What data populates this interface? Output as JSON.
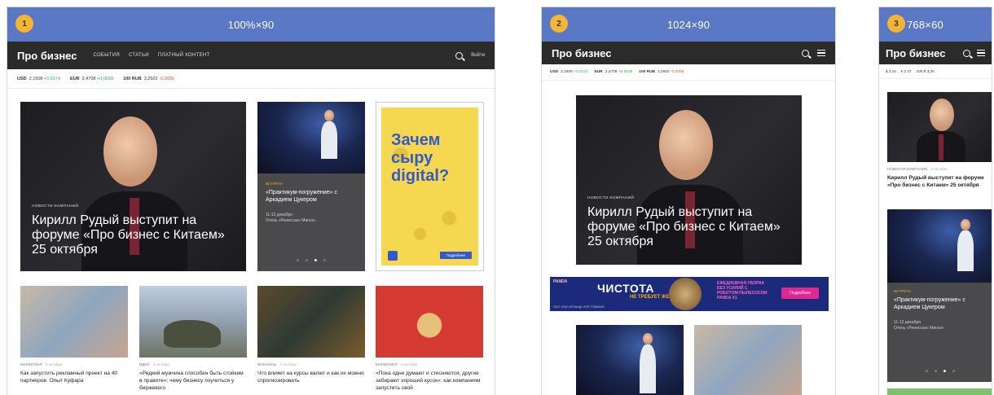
{
  "site": {
    "logo": "Про бизнес",
    "menu": [
      "События",
      "Статьи",
      "Платный контент"
    ],
    "login": "Войти"
  },
  "frames": [
    {
      "num": "1",
      "label": "100%×90"
    },
    {
      "num": "2",
      "label": "1024×90"
    },
    {
      "num": "3",
      "label": "768×60"
    }
  ],
  "currency": {
    "usd": {
      "code": "USD",
      "value": "2,1508",
      "delta": "+0,0174"
    },
    "eur": {
      "code": "EUR",
      "value": "2,4708",
      "delta": "+0,0018"
    },
    "rub": {
      "code": "100 RUB",
      "value": "3,2502",
      "delta": "-0,0056"
    },
    "short": {
      "usd": "$ 2,15",
      "eur": "€ 2,47",
      "rub": "100 ₽ 3,25"
    }
  },
  "hero": {
    "category": "Новости компаний",
    "title_lines": [
      "Кирилл Рудый выступит на",
      "форуме «Про бизнес с Китаем»",
      "25 октября"
    ],
    "mobile_category": "Новости компаний",
    "mobile_date": "3 октября",
    "mobile_title": "Кирилл Рудый выступит на форуме «Про бизнес с Китаем» 25 октября"
  },
  "event": {
    "category": "Встреча",
    "title": "«Практикум-погружение» с Аркадием Цукером",
    "date": "11-12 декабря",
    "place": "Отель «Ренессанс Минск»"
  },
  "ad_digital": {
    "lines": [
      "Зачем",
      "сыру",
      "digital?"
    ],
    "button": "Подробнее"
  },
  "cards": [
    {
      "category": "Маркетинг",
      "date": "5 октября",
      "title": "Как запустить рекламный проект на 40 партнеров. Опыт Куфара"
    },
    {
      "category": "Идеи",
      "date": "4 октября",
      "title": "«Редкий мужчина способен быть стойким в правоте»: чему бизнесу поучиться у биржевого"
    },
    {
      "category": "Финансы",
      "date": "4 октября",
      "title": "Что влияет на курсы валют и как их можно спрогнозировать"
    },
    {
      "category": "Маркетинг",
      "date": "4 октября",
      "title": "«Пока одни думают и стесняются, другие забирают хороший кусок»: как компаниям запустить свой"
    }
  ],
  "banner_panda": {
    "brand": "PANDA",
    "main": "ЧИСТОТА",
    "sub": "НЕ ТРЕБУЕТ ЖЕРТВ",
    "promo": [
      "ЕЖЕДНЕВНАЯ УБОРКА",
      "БЕЗ УСИЛИЙ С",
      "РОБОТОМ-ПЫЛЕСОСОМ",
      "PANDA X1"
    ],
    "button": "Подробнее",
    "foot": "ООО «ПОЛ ОРЛАНД» УНП 775584033"
  }
}
